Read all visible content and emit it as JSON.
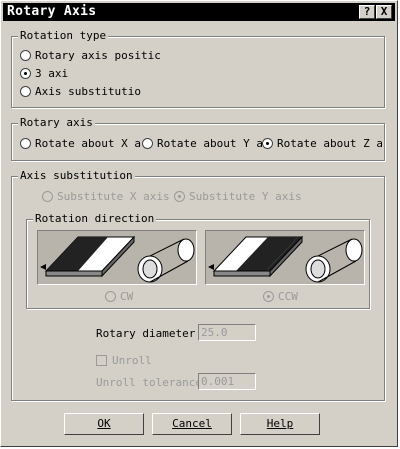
{
  "window": {
    "title": "Rotary Axis",
    "help_glyph": "?",
    "close_glyph": "X"
  },
  "rotation_type": {
    "legend": "Rotation type",
    "options": [
      "Rotary axis positic",
      "3 axi",
      "Axis substitutio"
    ],
    "selected": "3 axi"
  },
  "rotary_axis": {
    "legend": "Rotary axis",
    "options": [
      "Rotate about X as",
      "Rotate about Y as",
      "Rotate about Z as"
    ],
    "selected": "Rotate about Z as"
  },
  "axis_substitution": {
    "legend": "Axis substitution",
    "options": [
      "Substitute X axis",
      "Substitute Y axis"
    ],
    "selected": "Substitute Y axis",
    "rotation_direction": {
      "legend": "Rotation direction",
      "options": [
        "CW",
        "CCW"
      ],
      "selected": "CCW"
    },
    "rotary_diameter_label": "Rotary diameter",
    "rotary_diameter_value": "25.0",
    "unroll_label": "Unroll",
    "unroll_tolerance_label": "Unroll tolerance",
    "unroll_tolerance_value": "0.001"
  },
  "buttons": {
    "ok": "OK",
    "cancel": "Cancel",
    "help": "Help"
  },
  "icons": [
    "help-icon",
    "close-icon",
    "cw-rotation-illustration",
    "ccw-rotation-illustration"
  ]
}
